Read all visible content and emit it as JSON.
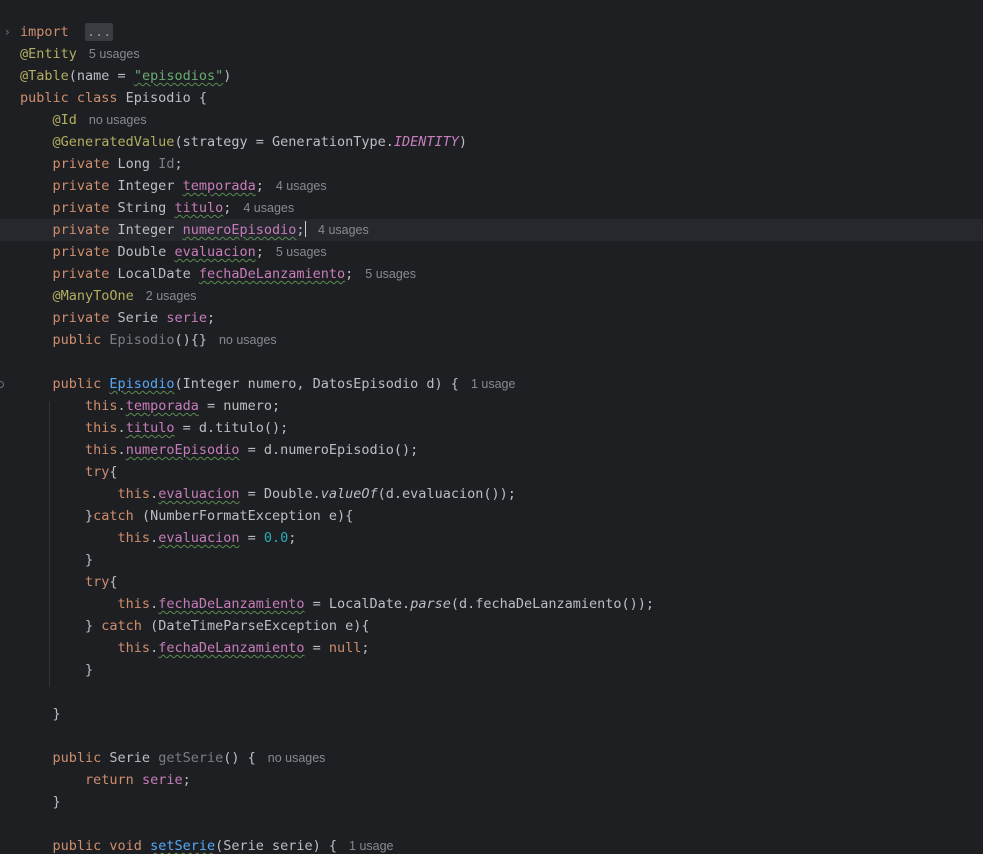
{
  "editor": {
    "fold_marker": "›",
    "folded_placeholder": "...",
    "lines": [
      {
        "indent": "",
        "parts": [
          [
            "kw",
            "import"
          ],
          [
            "",
            "  "
          ],
          [
            "fold-box",
            "..."
          ]
        ],
        "fold": true
      },
      {
        "indent": "",
        "parts": [
          [
            "ann",
            "@Entity"
          ]
        ],
        "hint": "5 usages"
      },
      {
        "indent": "",
        "parts": [
          [
            "ann",
            "@Table"
          ],
          [
            "",
            "(name = "
          ],
          [
            "str",
            "\"episodios\""
          ],
          [
            "",
            ")"
          ]
        ]
      },
      {
        "indent": "",
        "parts": [
          [
            "kw",
            "public class "
          ],
          [
            "",
            "Episodio {"
          ]
        ]
      },
      {
        "indent": "    ",
        "parts": [
          [
            "ann",
            "@Id"
          ]
        ],
        "hint": "no usages"
      },
      {
        "indent": "    ",
        "parts": [
          [
            "ann",
            "@GeneratedValue"
          ],
          [
            "",
            "(strategy = GenerationType."
          ],
          [
            "const",
            "IDENTITY"
          ],
          [
            "",
            ")"
          ]
        ]
      },
      {
        "indent": "    ",
        "parts": [
          [
            "kw",
            "private "
          ],
          [
            "",
            "Long "
          ],
          [
            "gray",
            "Id"
          ],
          [
            "",
            ";"
          ]
        ]
      },
      {
        "indent": "    ",
        "parts": [
          [
            "kw",
            "private "
          ],
          [
            "",
            "Integer "
          ],
          [
            "fld",
            "temporada"
          ],
          [
            "",
            ";"
          ]
        ],
        "hint": "4 usages"
      },
      {
        "indent": "    ",
        "parts": [
          [
            "kw",
            "private "
          ],
          [
            "",
            "String "
          ],
          [
            "fld",
            "titulo"
          ],
          [
            "",
            ";"
          ]
        ],
        "hint": "4 usages"
      },
      {
        "indent": "    ",
        "parts": [
          [
            "kw",
            "private "
          ],
          [
            "",
            "Integer "
          ],
          [
            "fld",
            "numeroEpisodio"
          ],
          [
            "",
            ";"
          ]
        ],
        "hint": "4 usages",
        "current": true
      },
      {
        "indent": "    ",
        "parts": [
          [
            "kw",
            "private "
          ],
          [
            "",
            "Double "
          ],
          [
            "fld",
            "evaluacion"
          ],
          [
            "",
            ";"
          ]
        ],
        "hint": "5 usages"
      },
      {
        "indent": "    ",
        "parts": [
          [
            "kw",
            "private "
          ],
          [
            "",
            "LocalDate "
          ],
          [
            "fld",
            "fechaDeLanzamiento"
          ],
          [
            "",
            ";"
          ]
        ],
        "hint": "5 usages"
      },
      {
        "indent": "    ",
        "parts": [
          [
            "ann",
            "@ManyToOne"
          ]
        ],
        "hint": "2 usages"
      },
      {
        "indent": "    ",
        "parts": [
          [
            "kw",
            "private "
          ],
          [
            "",
            "Serie "
          ],
          [
            "fld",
            "serie"
          ],
          [
            "",
            ";"
          ]
        ]
      },
      {
        "indent": "    ",
        "parts": [
          [
            "kw",
            "public "
          ],
          [
            "gray",
            "Episodio"
          ],
          [
            "",
            "(){}"
          ]
        ],
        "hint": "no usages"
      },
      {
        "indent": "",
        "parts": []
      },
      {
        "indent": "    ",
        "parts": [
          [
            "kw",
            "public "
          ],
          [
            "fn",
            "Episodio"
          ],
          [
            "",
            "(Integer numero, DatosEpisodio d) {"
          ]
        ],
        "hint": "1 usage",
        "marker": true
      },
      {
        "indent": "        ",
        "parts": [
          [
            "kw",
            "this"
          ],
          [
            "",
            "."
          ],
          [
            "fld",
            "temporada"
          ],
          [
            "",
            " = numero;"
          ]
        ]
      },
      {
        "indent": "        ",
        "parts": [
          [
            "kw",
            "this"
          ],
          [
            "",
            "."
          ],
          [
            "fld",
            "titulo"
          ],
          [
            "",
            " = d.titulo();"
          ]
        ]
      },
      {
        "indent": "        ",
        "parts": [
          [
            "kw",
            "this"
          ],
          [
            "",
            "."
          ],
          [
            "fld",
            "numeroEpisodio"
          ],
          [
            "",
            " = d.numeroEpisodio();"
          ]
        ]
      },
      {
        "indent": "        ",
        "parts": [
          [
            "kw",
            "try"
          ],
          [
            "",
            "{"
          ]
        ]
      },
      {
        "indent": "            ",
        "parts": [
          [
            "kw",
            "this"
          ],
          [
            "",
            "."
          ],
          [
            "fld",
            "evaluacion"
          ],
          [
            "",
            " = Double."
          ],
          [
            "it",
            "valueOf"
          ],
          [
            "",
            "(d.evaluacion());"
          ]
        ]
      },
      {
        "indent": "        ",
        "parts": [
          [
            "",
            "}"
          ],
          [
            "kw",
            "catch "
          ],
          [
            "",
            "(NumberFormatException e){"
          ]
        ]
      },
      {
        "indent": "            ",
        "parts": [
          [
            "kw",
            "this"
          ],
          [
            "",
            "."
          ],
          [
            "fld",
            "evaluacion"
          ],
          [
            "",
            " = "
          ],
          [
            "num",
            "0.0"
          ],
          [
            "",
            ";"
          ]
        ]
      },
      {
        "indent": "        ",
        "parts": [
          [
            "",
            "}"
          ]
        ]
      },
      {
        "indent": "        ",
        "parts": [
          [
            "kw",
            "try"
          ],
          [
            "",
            "{"
          ]
        ]
      },
      {
        "indent": "            ",
        "parts": [
          [
            "kw",
            "this"
          ],
          [
            "",
            "."
          ],
          [
            "fld",
            "fechaDeLanzamiento"
          ],
          [
            "",
            " = LocalDate."
          ],
          [
            "it",
            "parse"
          ],
          [
            "",
            "(d.fechaDeLanzamiento());"
          ]
        ]
      },
      {
        "indent": "        ",
        "parts": [
          [
            "",
            "} "
          ],
          [
            "kw",
            "catch "
          ],
          [
            "",
            "(DateTimeParseException e){"
          ]
        ]
      },
      {
        "indent": "            ",
        "parts": [
          [
            "kw",
            "this"
          ],
          [
            "",
            "."
          ],
          [
            "fld",
            "fechaDeLanzamiento"
          ],
          [
            "",
            " = "
          ],
          [
            "kw",
            "null"
          ],
          [
            "",
            ";"
          ]
        ]
      },
      {
        "indent": "        ",
        "parts": [
          [
            "",
            "}"
          ]
        ]
      },
      {
        "indent": "",
        "parts": []
      },
      {
        "indent": "    ",
        "parts": [
          [
            "",
            "}"
          ]
        ]
      },
      {
        "indent": "",
        "parts": []
      },
      {
        "indent": "    ",
        "parts": [
          [
            "kw",
            "public "
          ],
          [
            "",
            "Serie "
          ],
          [
            "gray",
            "getSerie"
          ],
          [
            "",
            "() {"
          ]
        ],
        "hint": "no usages"
      },
      {
        "indent": "        ",
        "parts": [
          [
            "kw",
            "return "
          ],
          [
            "fld",
            "serie"
          ],
          [
            "",
            ";"
          ]
        ]
      },
      {
        "indent": "    ",
        "parts": [
          [
            "",
            "}"
          ]
        ]
      },
      {
        "indent": "",
        "parts": []
      },
      {
        "indent": "    ",
        "parts": [
          [
            "kw",
            "public void "
          ],
          [
            "fn",
            "setSerie"
          ],
          [
            "",
            "(Serie serie) {"
          ]
        ],
        "hint": "1 usage"
      }
    ]
  }
}
